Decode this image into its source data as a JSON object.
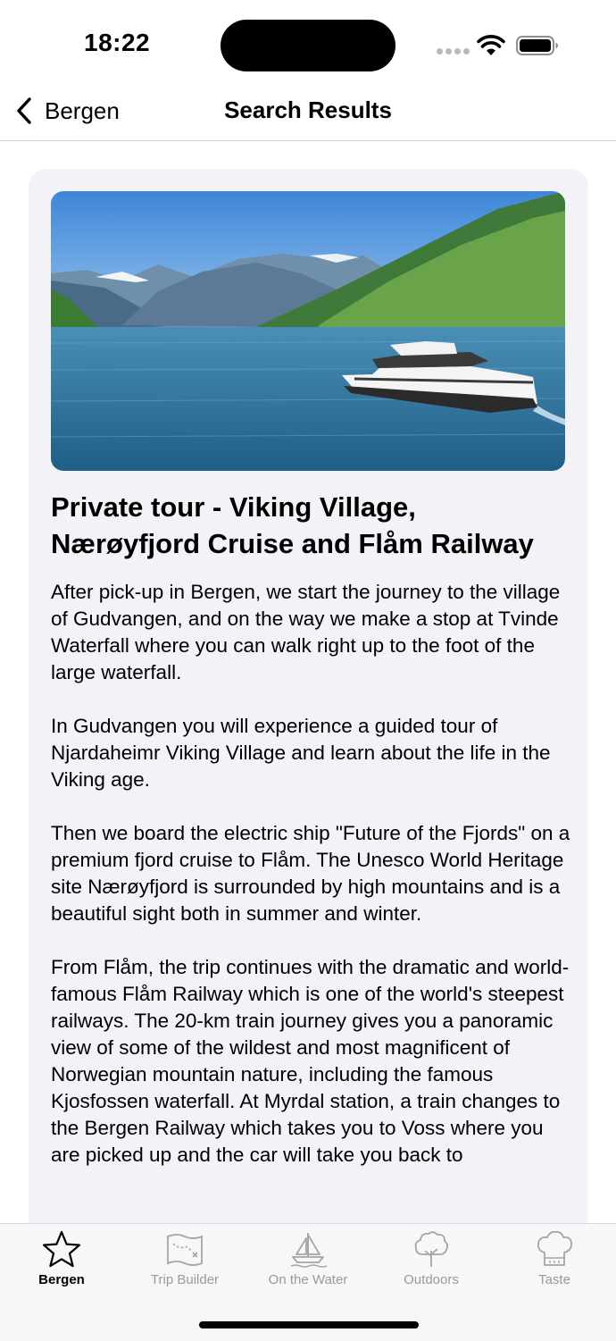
{
  "status_bar": {
    "time": "18:22"
  },
  "nav": {
    "back_label": "Bergen",
    "title": "Search Results"
  },
  "card": {
    "image_icon": "fjord-ferry-photo",
    "title": "Private tour - Viking Village, Nærøyfjord Cruise and Flåm Railway",
    "paragraphs": [
      "After pick-up in Bergen, we start the journey to the village of Gudvangen, and on the way we make a stop at Tvinde Waterfall where you can walk right up to the foot of the large waterfall.",
      "In Gudvangen you will experience a guided tour of Njardaheimr Viking Village and learn about the life in the Viking age.",
      "Then we board the electric ship \"Future of the Fjords\" on a premium fjord cruise to Flåm. The Unesco World Heritage site Nærøyfjord is surrounded by high mountains and is a beautiful sight both in summer and winter.",
      "From Flåm, the trip continues with the dramatic and world-famous Flåm Railway which is one of the world's steepest railways. The 20-km train journey gives you a panoramic view of some of the wildest and most magnificent of Norwegian mountain nature, including the famous Kjosfossen waterfall. At Myrdal station, a train changes to the Bergen Railway which takes you to Voss where you are picked up and the car will take you back to"
    ]
  },
  "tabs": [
    {
      "label": "Bergen",
      "icon": "star-icon",
      "active": true
    },
    {
      "label": "Trip Builder",
      "icon": "treasure-map-icon",
      "active": false
    },
    {
      "label": "On the Water",
      "icon": "sailboat-icon",
      "active": false
    },
    {
      "label": "Outdoors",
      "icon": "tree-icon",
      "active": false
    },
    {
      "label": "Taste",
      "icon": "chef-hat-icon",
      "active": false
    }
  ],
  "colors": {
    "active_tab": "#000000",
    "inactive_tab": "#9a9a9e",
    "card_bg": "#f2f2f7"
  }
}
